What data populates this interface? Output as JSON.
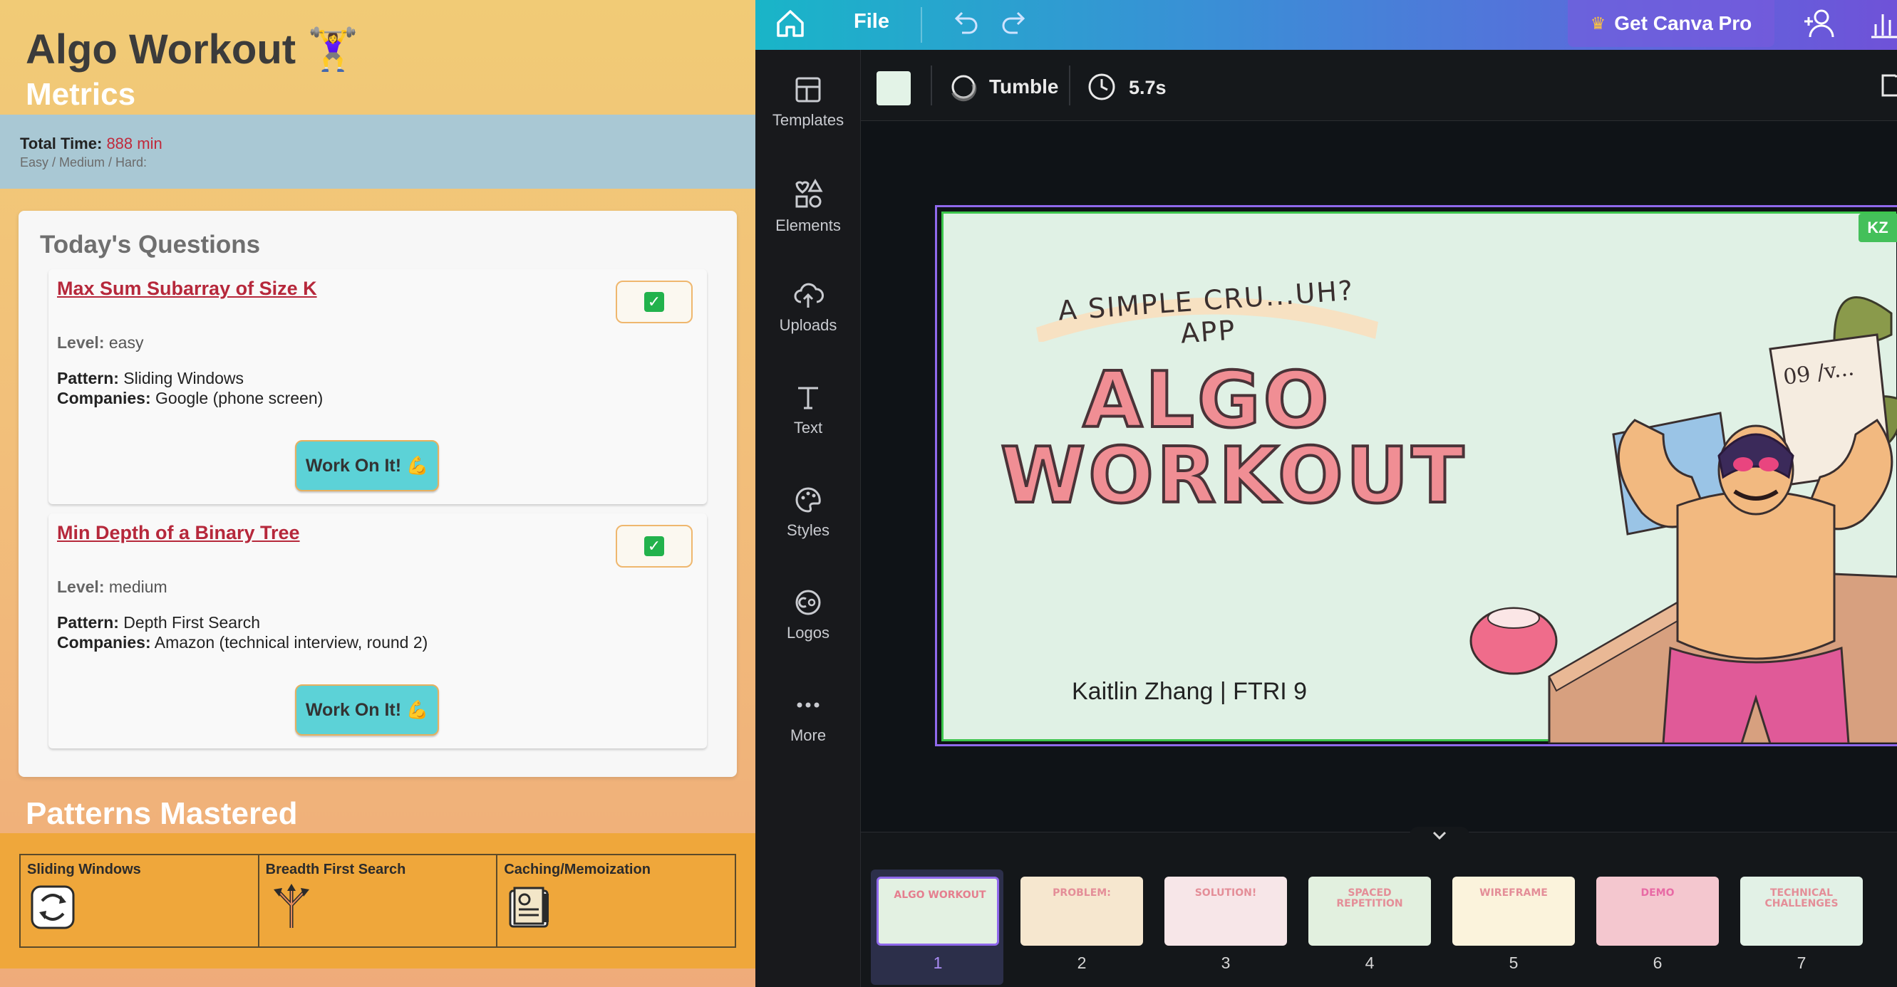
{
  "left": {
    "app_title": "Algo Workout 🏋️‍♀️",
    "metrics_title": "Metrics",
    "total_time_label": "Total Time:",
    "total_time_value": "888 min",
    "difficulty_line": "Easy / Medium / Hard:",
    "questions_title": "Today's Questions",
    "questions": [
      {
        "title": "Max Sum Subarray of Size K",
        "level_label": "Level:",
        "level": "easy",
        "pattern_label": "Pattern:",
        "pattern": "Sliding Windows",
        "companies_label": "Companies:",
        "companies": "Google (phone screen)",
        "check": "✓",
        "button": "Work On It! 💪"
      },
      {
        "title": "Min Depth of a Binary Tree",
        "level_label": "Level:",
        "level": "medium",
        "pattern_label": "Pattern:",
        "pattern": "Depth First Search",
        "companies_label": "Companies:",
        "companies": "Amazon (technical interview, round 2)",
        "check": "✓",
        "button": "Work On It! 💪"
      }
    ],
    "patterns_title": "Patterns Mastered",
    "patterns": [
      {
        "label": "Sliding Windows",
        "icon": "arrows-cycle-icon"
      },
      {
        "label": "Breadth First Search",
        "icon": "branching-arrows-icon"
      },
      {
        "label": "Caching/Memoization",
        "icon": "notebook-icon"
      }
    ]
  },
  "canva": {
    "file_menu": "File",
    "get_pro": "Get Canva Pro",
    "pro_icon": "crown-icon",
    "sidebar": [
      {
        "label": "Templates",
        "icon": "templates-icon"
      },
      {
        "label": "Elements",
        "icon": "elements-icon"
      },
      {
        "label": "Uploads",
        "icon": "upload-cloud-icon"
      },
      {
        "label": "Text",
        "icon": "text-icon"
      },
      {
        "label": "Styles",
        "icon": "palette-icon"
      },
      {
        "label": "Logos",
        "icon": "logo-icon"
      },
      {
        "label": "More",
        "icon": "more-dots-icon"
      }
    ],
    "animation": "Tumble",
    "duration": "5.7s",
    "background_color": "#e3f3e7",
    "collaborator": "KZ",
    "slide": {
      "tagline": "A SIMPLE CRU...UH? APP",
      "title_line1": "ALGO",
      "title_line2": "WORKOUT",
      "byline": "Kaitlin Zhang | FTRI 9"
    },
    "thumbnails": [
      {
        "num": "1",
        "bg": "#e3f1e2",
        "text": "ALGO WORKOUT",
        "color": "#e57f8f"
      },
      {
        "num": "2",
        "bg": "#f6e7cf",
        "text": "PROBLEM:",
        "color": "#e48e98"
      },
      {
        "num": "3",
        "bg": "#f7e6e8",
        "text": "SOLUTION!",
        "color": "#e48e98"
      },
      {
        "num": "4",
        "bg": "#e2f0df",
        "text": "SPACED REPETITION",
        "color": "#e48e98"
      },
      {
        "num": "5",
        "bg": "#fbf3dc",
        "text": "WIREFRAME",
        "color": "#e48e98"
      },
      {
        "num": "6",
        "bg": "#f4c7cf",
        "text": "DEMO",
        "color": "#e86aa5"
      },
      {
        "num": "7",
        "bg": "#e2f1e6",
        "text": "TECHNICAL CHALLENGES",
        "color": "#e48e98"
      }
    ]
  }
}
